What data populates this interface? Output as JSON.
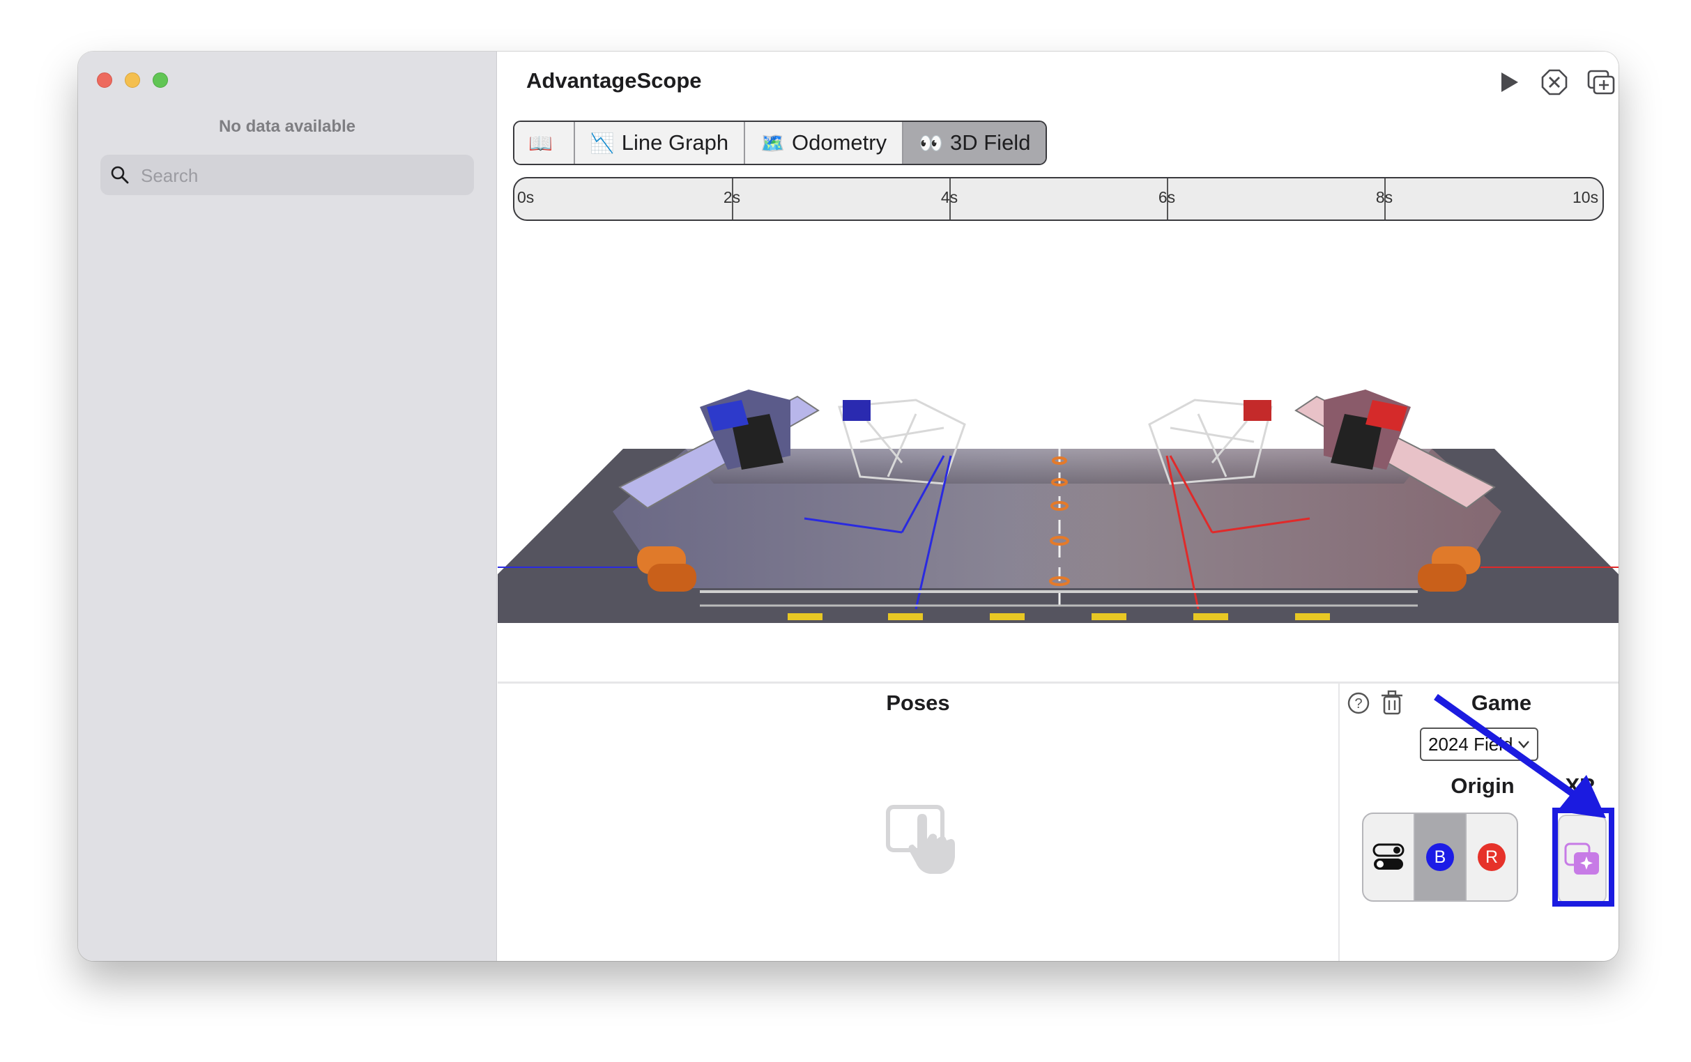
{
  "sidebar": {
    "status": "No data available",
    "search_placeholder": "Search"
  },
  "header": {
    "title": "AdvantageScope",
    "toolbar": [
      "play-icon",
      "close-circle-icon",
      "new-window-icon",
      "plus-icon"
    ]
  },
  "tabs": [
    {
      "glyph": "📖",
      "label": ""
    },
    {
      "glyph": "📉",
      "label": "Line Graph"
    },
    {
      "glyph": "🗺️",
      "label": "Odometry"
    },
    {
      "glyph": "👀",
      "label": "3D Field",
      "active": true
    }
  ],
  "timeline": {
    "ticks": [
      "0s",
      "2s",
      "4s",
      "6s",
      "8s",
      "10s"
    ]
  },
  "poses": {
    "title": "Poses"
  },
  "game": {
    "title": "Game",
    "selected": "2024 Field"
  },
  "origin": {
    "title": "Origin",
    "options": [
      "B",
      "R"
    ],
    "active_index": 1
  },
  "xr": {
    "title": "XR"
  },
  "colors": {
    "highlight": "#1b1be0",
    "blue_alliance": "#1c1ce6",
    "red_alliance": "#e6322a",
    "xr_icon": "#c77be6"
  }
}
